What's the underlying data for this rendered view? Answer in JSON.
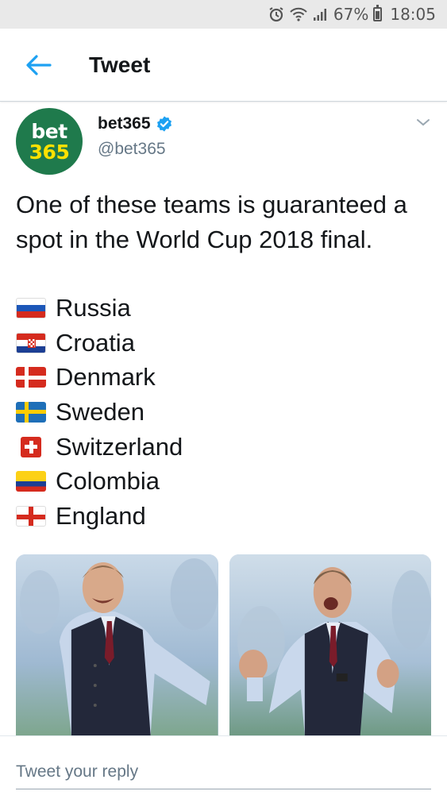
{
  "status_bar": {
    "battery_percent": "67%",
    "time": "18:05",
    "icons": [
      "alarm-icon",
      "wifi-icon",
      "signal-icon",
      "battery-icon"
    ]
  },
  "header": {
    "title": "Tweet",
    "back_icon": "back-arrow-icon"
  },
  "tweet": {
    "avatar": {
      "line1": "bet",
      "line2": "365",
      "bg": "#1f7a4c",
      "accent": "#ffe100"
    },
    "display_name": "bet365",
    "verified": true,
    "handle": "@bet365",
    "text": "One of these teams is guaranteed a spot in the World Cup 2018 final.",
    "teams": [
      {
        "flag": "russia",
        "name": "Russia"
      },
      {
        "flag": "croatia",
        "name": "Croatia"
      },
      {
        "flag": "denmark",
        "name": "Denmark"
      },
      {
        "flag": "sweden",
        "name": "Sweden"
      },
      {
        "flag": "switzerland",
        "name": "Switzerland"
      },
      {
        "flag": "colombia",
        "name": "Colombia"
      },
      {
        "flag": "england",
        "name": "England"
      }
    ],
    "media_count": 2
  },
  "reply": {
    "placeholder": "Tweet your reply"
  },
  "colors": {
    "accent": "#1da1f2",
    "text": "#14171a",
    "muted": "#657786"
  }
}
